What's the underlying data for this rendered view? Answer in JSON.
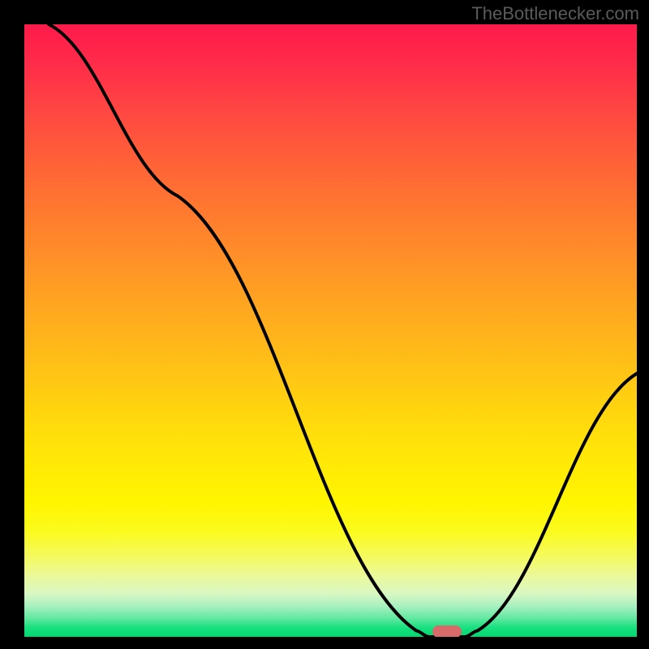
{
  "watermark": "TheBottlenecker.com",
  "chart_data": {
    "type": "line",
    "title": "",
    "xlabel": "",
    "ylabel": "",
    "xlim": [
      0,
      100
    ],
    "ylim": [
      0,
      100
    ],
    "line": {
      "points": [
        {
          "x": 4,
          "y": 100
        },
        {
          "x": 25,
          "y": 72
        },
        {
          "x": 64,
          "y": 1
        },
        {
          "x": 66,
          "y": 0
        },
        {
          "x": 72,
          "y": 0
        },
        {
          "x": 74,
          "y": 1
        },
        {
          "x": 100,
          "y": 43
        }
      ],
      "color": "#000000"
    },
    "marker": {
      "x": 69,
      "y": 0.5,
      "color": "#d86a6a"
    },
    "background_gradient": {
      "top": "#ff1a4a",
      "middle": "#ffd000",
      "bottom": "#00d870"
    }
  }
}
